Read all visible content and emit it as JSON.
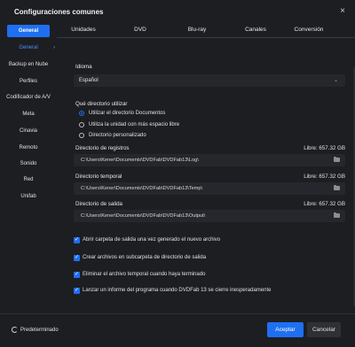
{
  "window": {
    "title": "Configuraciones comunes",
    "close_icon": "×"
  },
  "sidebar": {
    "items": [
      {
        "label": "General",
        "state": "active"
      },
      {
        "label": "General",
        "state": "sub",
        "chevron": "›"
      },
      {
        "label": "Backup en Nube"
      },
      {
        "label": "Perfiles"
      },
      {
        "label": "Codificador de A/V"
      },
      {
        "label": "Meta"
      },
      {
        "label": "Cinavia"
      },
      {
        "label": "Remoto"
      },
      {
        "label": "Sonido"
      },
      {
        "label": "Red"
      },
      {
        "label": "Unifab"
      }
    ]
  },
  "tabs": [
    "Unidades",
    "DVD",
    "Blu-ray",
    "Canales",
    "Conversión"
  ],
  "main": {
    "language_label": "Idioma",
    "language_value": "Español",
    "dropdown_arrow": "⌄",
    "dir_label": "Qué directorio utilizar",
    "radios": [
      {
        "label": "Utilizar el directorio Documentos",
        "selected": true
      },
      {
        "label": "Utiliza la unidad con más espacio libre",
        "selected": false
      },
      {
        "label": "Directorio personalizado",
        "selected": false
      }
    ],
    "dirs": [
      {
        "label": "Directorio de registros",
        "free": "Libre: 657.32 GB",
        "path": "C:\\Users\\Kener\\Documents\\DVDFab\\DVDFab13\\Log\\"
      },
      {
        "label": "Directorio temporal",
        "free": "Libre: 657.32 GB",
        "path": "C:\\Users\\Kener\\Documents\\DVDFab\\DVDFab13\\Temp\\"
      },
      {
        "label": "Directorio de salida",
        "free": "Libre: 657.32 GB",
        "path": "C:\\Users\\Kener\\Documents\\DVDFab\\DVDFab13\\Output\\"
      }
    ],
    "checks": [
      {
        "label": "Abrir carpeta de salida una vez generado el nuevo archivo",
        "checked": true
      },
      {
        "label": "Crear archivos en subcarpeta de directorio de salida",
        "checked": true
      },
      {
        "label": "Eliminar el archivo temporal cuando haya terminado",
        "checked": true
      },
      {
        "label": "Lanzar un informe del programa cuando DVDFab 13 se cierre inesperadamente",
        "checked": true
      }
    ],
    "check_mark": "✓"
  },
  "footer": {
    "default_label": "Predeterminado",
    "ok_label": "Aceptar",
    "cancel_label": "Cancelar"
  },
  "colors": {
    "accent": "#1f6ff2",
    "background": "#1d1e22",
    "field": "#26272c"
  }
}
